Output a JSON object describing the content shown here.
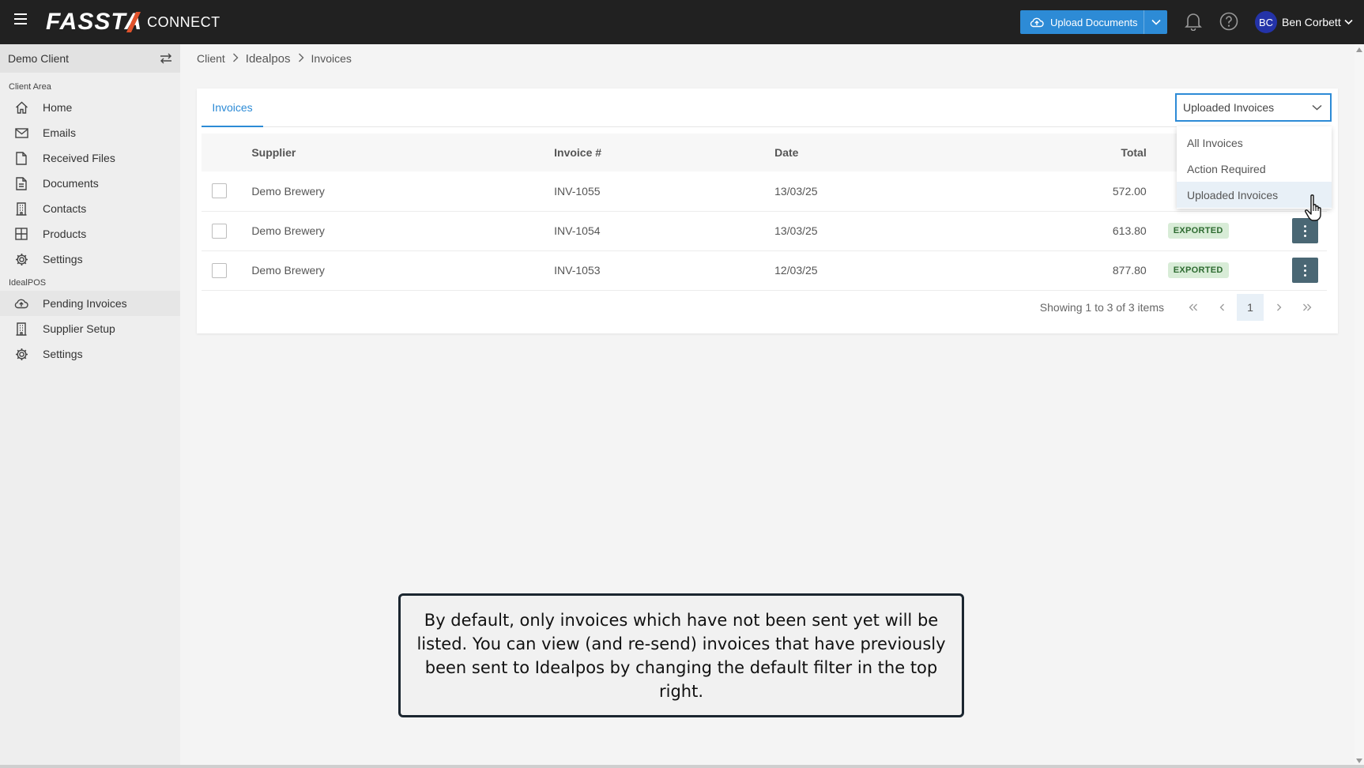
{
  "app": {
    "logo_text": "FASSTA",
    "logo_sub": "CONNECT",
    "upload_label": "Upload Documents",
    "user_initials": "BC",
    "user_name": "Ben Corbett"
  },
  "sidebar": {
    "client_name": "Demo Client",
    "sections": [
      {
        "label": "Client Area",
        "items": [
          {
            "label": "Home",
            "icon": "home-icon"
          },
          {
            "label": "Emails",
            "icon": "mail-icon"
          },
          {
            "label": "Received Files",
            "icon": "file-icon"
          },
          {
            "label": "Documents",
            "icon": "document-icon"
          },
          {
            "label": "Contacts",
            "icon": "building-icon"
          },
          {
            "label": "Products",
            "icon": "grid-icon"
          },
          {
            "label": "Settings",
            "icon": "gear-icon"
          }
        ]
      },
      {
        "label": "IdealPOS",
        "items": [
          {
            "label": "Pending Invoices",
            "icon": "cloud-upload-icon"
          },
          {
            "label": "Supplier Setup",
            "icon": "building-icon"
          },
          {
            "label": "Settings",
            "icon": "gear-icon"
          }
        ]
      }
    ]
  },
  "breadcrumb": [
    "Client",
    "Idealpos",
    "Invoices"
  ],
  "tabs": [
    "Invoices"
  ],
  "table": {
    "headers": [
      "Supplier",
      "Invoice #",
      "Date",
      "Total"
    ],
    "rows": [
      {
        "supplier": "Demo Brewery",
        "invoice": "INV-1055",
        "date": "13/03/25",
        "total": "572.00",
        "status": ""
      },
      {
        "supplier": "Demo Brewery",
        "invoice": "INV-1054",
        "date": "13/03/25",
        "total": "613.80",
        "status": "EXPORTED"
      },
      {
        "supplier": "Demo Brewery",
        "invoice": "INV-1053",
        "date": "12/03/25",
        "total": "877.80",
        "status": "EXPORTED"
      }
    ]
  },
  "pager": {
    "info": "Showing 1 to 3 of 3 items",
    "current_page": "1"
  },
  "filter": {
    "selected": "Uploaded Invoices",
    "options": [
      "All Invoices",
      "Action Required",
      "Uploaded Invoices"
    ]
  },
  "callout": {
    "text": "By default, only invoices which have not been sent yet will be listed. You can view (and re-send) invoices that have previously been sent to Idealpos by changing the default filter in the top right."
  },
  "colors": {
    "accent": "#2d8bd6",
    "topbar": "#212121",
    "badge_bg": "#d8ecd7",
    "badge_text": "#2e6b31",
    "kebab_bg": "#4a6774"
  }
}
